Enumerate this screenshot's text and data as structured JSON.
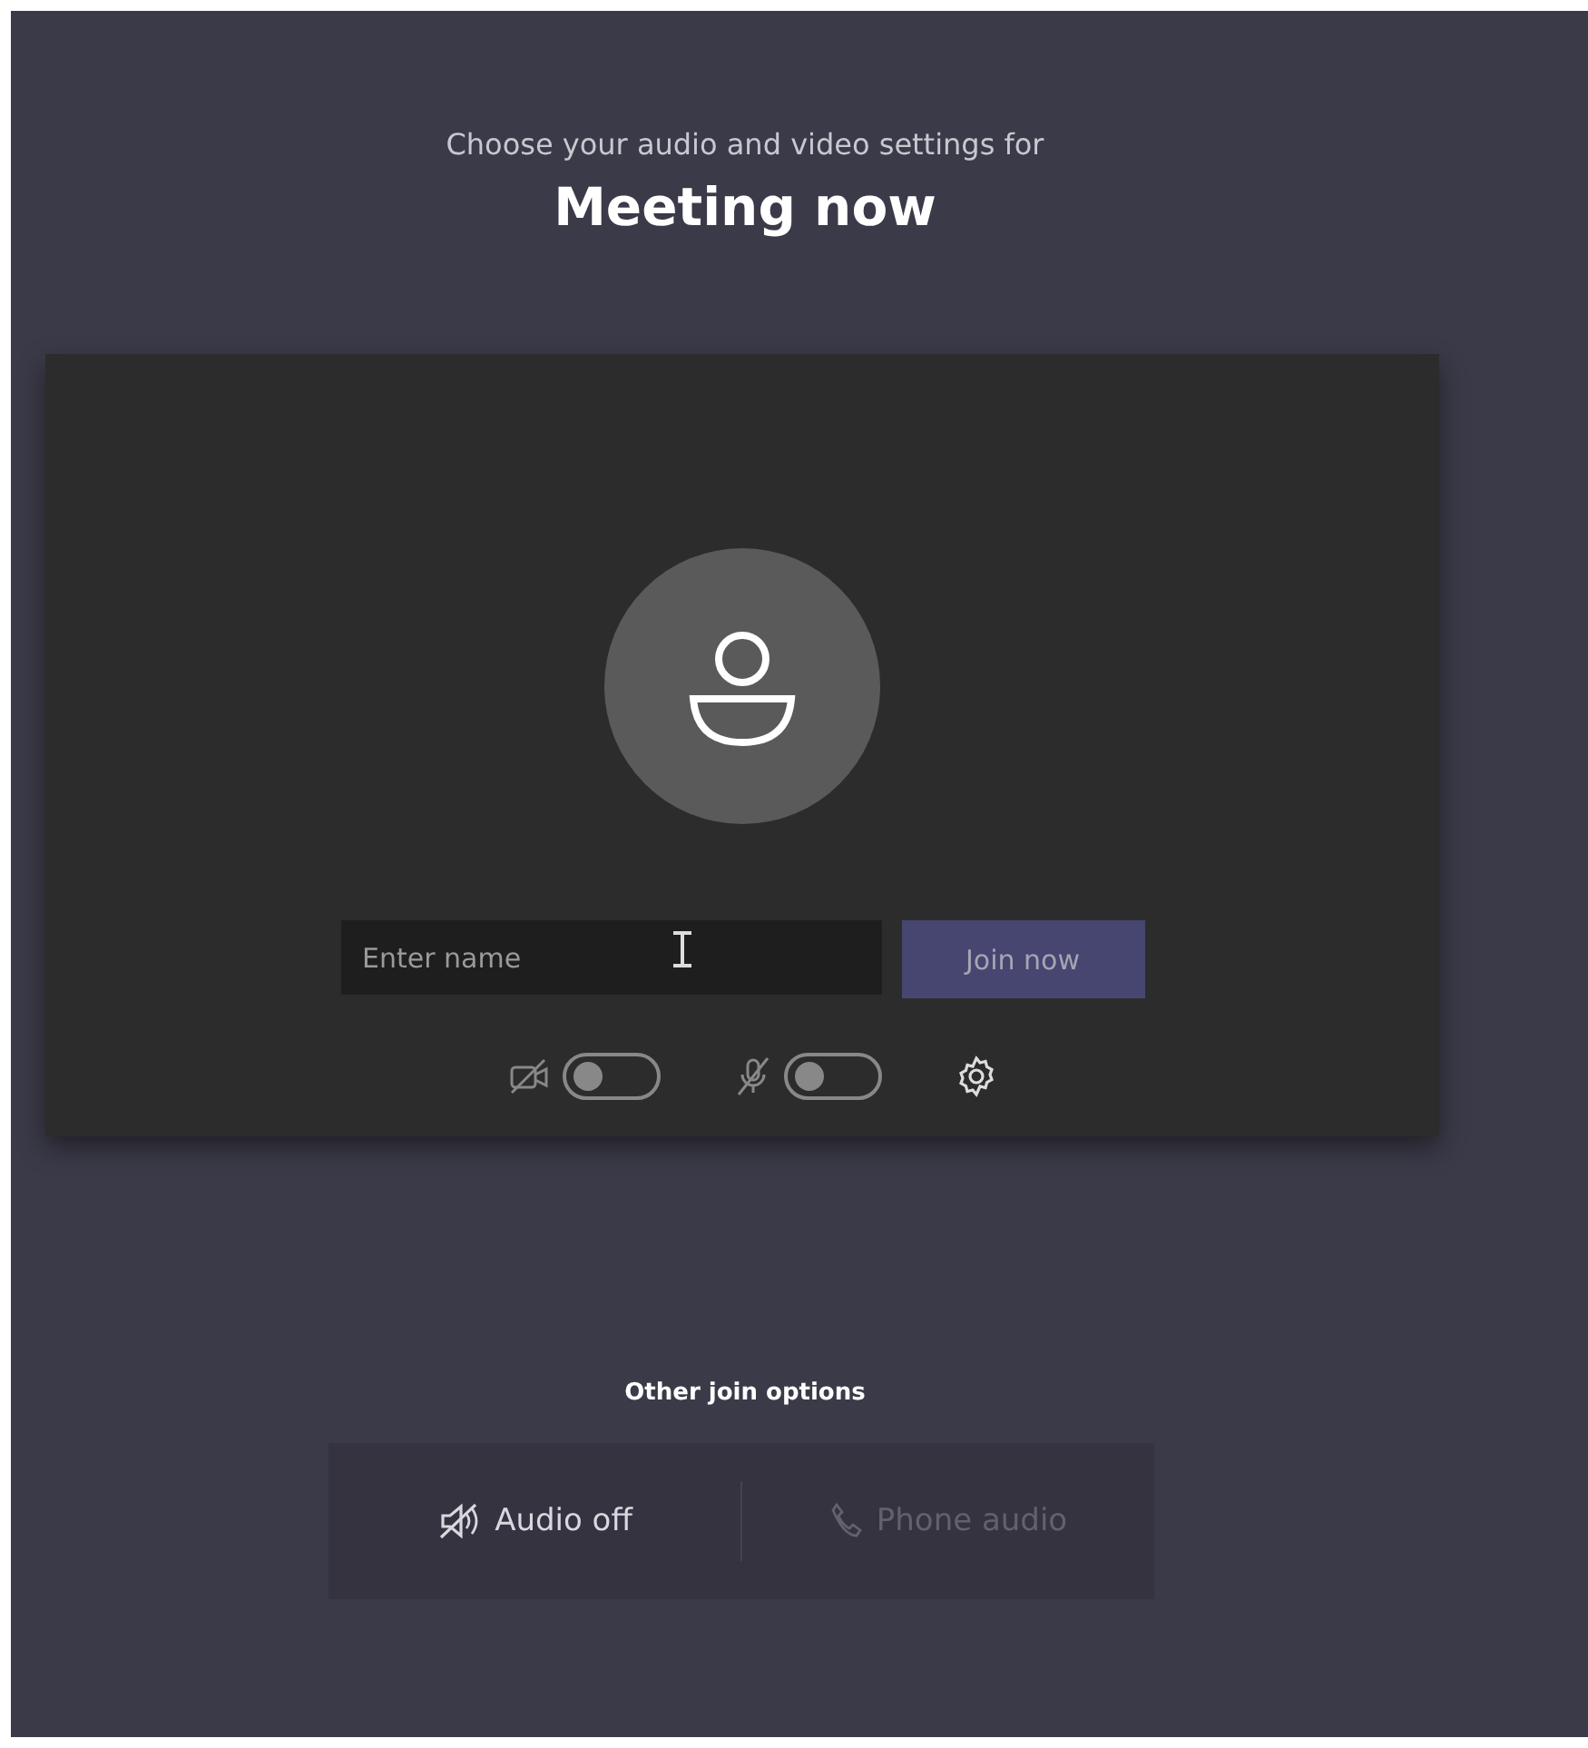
{
  "heading": "Choose your audio and video settings for",
  "title": "Meeting now",
  "name_field": {
    "placeholder": "Enter name"
  },
  "join_button": {
    "label": "Join now",
    "disabled": true
  },
  "toggles": [
    {
      "kind": "camera",
      "on": false
    },
    {
      "kind": "microphone",
      "on": false
    }
  ],
  "other_options": {
    "title": "Other join options",
    "options": [
      {
        "kind": "audio-off",
        "label": "Audio off",
        "disabled": false
      },
      {
        "kind": "phone",
        "label": "Phone audio",
        "disabled": true
      }
    ]
  }
}
